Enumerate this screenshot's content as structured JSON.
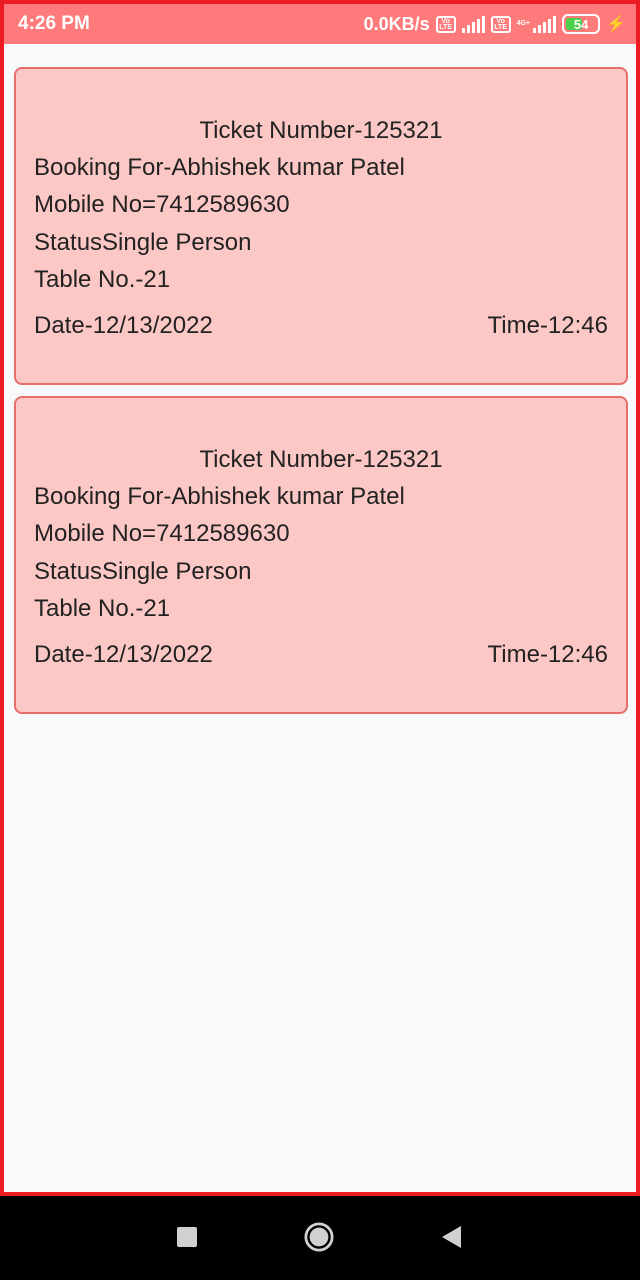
{
  "status_bar": {
    "time": "4:26 PM",
    "network_speed": "0.0KB/s",
    "network_type": "4G+",
    "battery_level": "54",
    "volte_label": "Vo LTE"
  },
  "tickets": [
    {
      "ticket_number": "Ticket Number-125321",
      "booking_for": "Booking For-Abhishek kumar Patel",
      "mobile": "Mobile No=7412589630",
      "status": "StatusSingle Person",
      "table_no": "Table No.-21",
      "date": "Date-12/13/2022",
      "time": "Time-12:46"
    },
    {
      "ticket_number": "Ticket Number-125321",
      "booking_for": "Booking For-Abhishek kumar Patel",
      "mobile": "Mobile No=7412589630",
      "status": "StatusSingle Person",
      "table_no": "Table No.-21",
      "date": "Date-12/13/2022",
      "time": "Time-12:46"
    }
  ],
  "colors": {
    "status_bar": "#ff7b7b",
    "card_background": "#fcc8c6",
    "card_border": "#e86d6d",
    "frame_border": "#ec1c24",
    "battery_fill": "#49d14b"
  },
  "nav_bar": {
    "recents_icon": "square-icon",
    "home_icon": "circle-icon",
    "back_icon": "triangle-back-icon"
  }
}
